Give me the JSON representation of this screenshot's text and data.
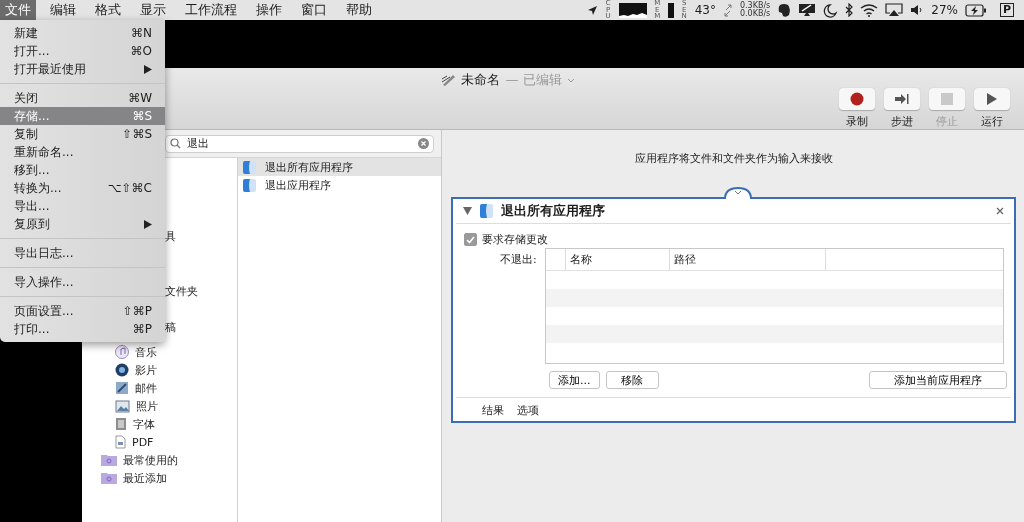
{
  "menu_bar": {
    "menus": [
      {
        "label": "文件",
        "selected": true
      },
      {
        "label": "编辑",
        "selected": false
      },
      {
        "label": "格式",
        "selected": false
      },
      {
        "label": "显示",
        "selected": false
      },
      {
        "label": "工作流程",
        "selected": false
      },
      {
        "label": "操作",
        "selected": false
      },
      {
        "label": "窗口",
        "selected": false
      },
      {
        "label": "帮助",
        "selected": false
      }
    ],
    "status": {
      "cpu_label": "CPU",
      "mem_label": "MEM",
      "sensor_label": "SEN",
      "temperature": "43°",
      "upload": "0.3KB/s",
      "download": "0.0KB/s",
      "battery": "27%",
      "keyboard": "P"
    }
  },
  "file_menu": [
    {
      "kind": "item",
      "label": "新建",
      "shortcut": "⌘N",
      "selected": false
    },
    {
      "kind": "item",
      "label": "打开...",
      "shortcut": "⌘O",
      "selected": false
    },
    {
      "kind": "submenu",
      "label": "打开最近使用",
      "selected": false
    },
    {
      "kind": "separator"
    },
    {
      "kind": "item",
      "label": "关闭",
      "shortcut": "⌘W",
      "selected": false
    },
    {
      "kind": "item",
      "label": "存储...",
      "shortcut": "⌘S",
      "selected": true
    },
    {
      "kind": "item",
      "label": "复制",
      "shortcut": "⇧⌘S",
      "selected": false
    },
    {
      "kind": "item",
      "label": "重新命名...",
      "selected": false
    },
    {
      "kind": "item",
      "label": "移到...",
      "selected": false
    },
    {
      "kind": "item",
      "label": "转换为...",
      "shortcut": "⌥⇧⌘C",
      "selected": false
    },
    {
      "kind": "item",
      "label": "导出...",
      "selected": false
    },
    {
      "kind": "submenu",
      "label": "复原到",
      "selected": false
    },
    {
      "kind": "separator"
    },
    {
      "kind": "item",
      "label": "导出日志...",
      "selected": false
    },
    {
      "kind": "separator"
    },
    {
      "kind": "item",
      "label": "导入操作...",
      "selected": false
    },
    {
      "kind": "separator"
    },
    {
      "kind": "item",
      "label": "页面设置...",
      "shortcut": "⇧⌘P",
      "selected": false
    },
    {
      "kind": "item",
      "label": "打印...",
      "shortcut": "⌘P",
      "selected": false
    }
  ],
  "window": {
    "title": "未命名",
    "subtitle": "— 已编辑"
  },
  "toolbar": {
    "buttons": [
      {
        "label": "录制",
        "kind": "record",
        "disabled": false
      },
      {
        "label": "步进",
        "kind": "step",
        "disabled": false
      },
      {
        "label": "停止",
        "kind": "stop",
        "disabled": true
      },
      {
        "label": "运行",
        "kind": "run",
        "disabled": false
      }
    ]
  },
  "search": {
    "value": "退出"
  },
  "library": {
    "partial_items": [
      "具",
      "文件夹",
      "稿"
    ],
    "items": [
      {
        "label": "音乐",
        "kind": "music"
      },
      {
        "label": "影片",
        "kind": "movie"
      },
      {
        "label": "邮件",
        "kind": "mail"
      },
      {
        "label": "照片",
        "kind": "photo"
      },
      {
        "label": "字体",
        "kind": "font"
      },
      {
        "label": "PDF",
        "kind": "pdf"
      }
    ],
    "smart_folders": [
      {
        "label": "最常使用的"
      },
      {
        "label": "最近添加"
      }
    ]
  },
  "actions": [
    {
      "label": "退出所有应用程序",
      "selected": true
    },
    {
      "label": "退出应用程序",
      "selected": false
    }
  ],
  "workflow": {
    "input_hint": "应用程序将文件和文件夹作为输入来接收",
    "action": {
      "title": "退出所有应用程序",
      "checkbox": {
        "label": "要求存储更改",
        "checked": true
      },
      "exclude_label": "不退出:",
      "columns": [
        "名称",
        "路径"
      ],
      "buttons": [
        "添加...",
        "移除"
      ],
      "add_current_button": "添加当前应用程序",
      "footer_tabs": [
        "结果",
        "选项"
      ]
    }
  }
}
